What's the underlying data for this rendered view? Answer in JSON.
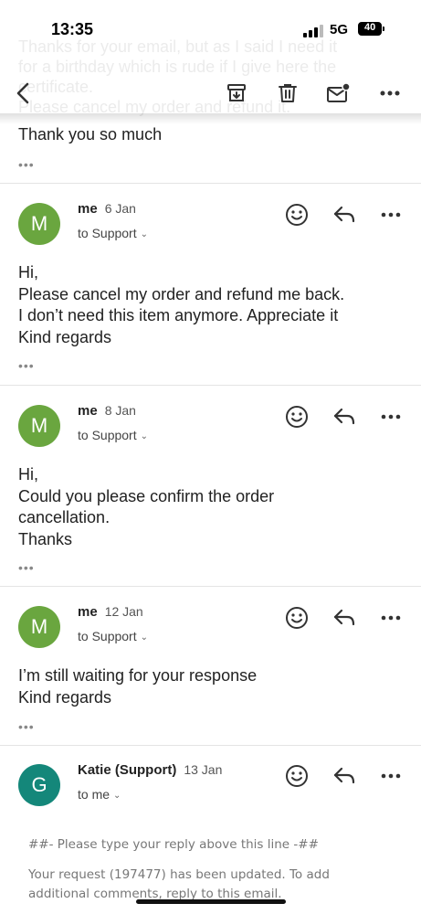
{
  "status_bar": {
    "time": "13:35",
    "network": "5G",
    "battery": "40"
  },
  "ghost_text": [
    "Thanks for your email, but as I said I need it",
    "for a birthday which is rude if I give here the",
    "certificate.",
    "Please cancel my order and refund it."
  ],
  "toolbar": {
    "back_icon": "chevron-left-icon",
    "archive_icon": "archive-icon",
    "delete_icon": "trash-icon",
    "unread_icon": "mark-unread-icon",
    "more_icon": "more-horizontal-icon"
  },
  "prior_message": {
    "last_line": "Thank you so much",
    "more": "•••"
  },
  "messages": [
    {
      "avatar": "M",
      "avatar_color": "#6aa63f",
      "sender": "me",
      "date": "6 Jan",
      "recipient": "to Support",
      "body": [
        "Hi,",
        "Please cancel my order and refund me back.",
        "I don’t need this item anymore. Appreciate it",
        "Kind regards"
      ],
      "more": "•••"
    },
    {
      "avatar": "M",
      "avatar_color": "#6aa63f",
      "sender": "me",
      "date": "8 Jan",
      "recipient": "to Support",
      "body": [
        "Hi,",
        "Could you please confirm the order",
        "cancellation.",
        "Thanks"
      ],
      "more": "•••"
    },
    {
      "avatar": "M",
      "avatar_color": "#6aa63f",
      "sender": "me",
      "date": "12 Jan",
      "recipient": "to Support",
      "body": [
        "I’m still waiting for your response",
        "Kind regards"
      ],
      "more": "•••"
    },
    {
      "avatar": "G",
      "avatar_color": "#14877a",
      "sender": "Katie (Support)",
      "date": "13 Jan",
      "recipient": "to me",
      "quoted": [
        "##- Please type your reply above this line -##",
        "",
        "Your request (197477) has been updated. To add",
        "additional comments, reply to this email."
      ]
    }
  ]
}
